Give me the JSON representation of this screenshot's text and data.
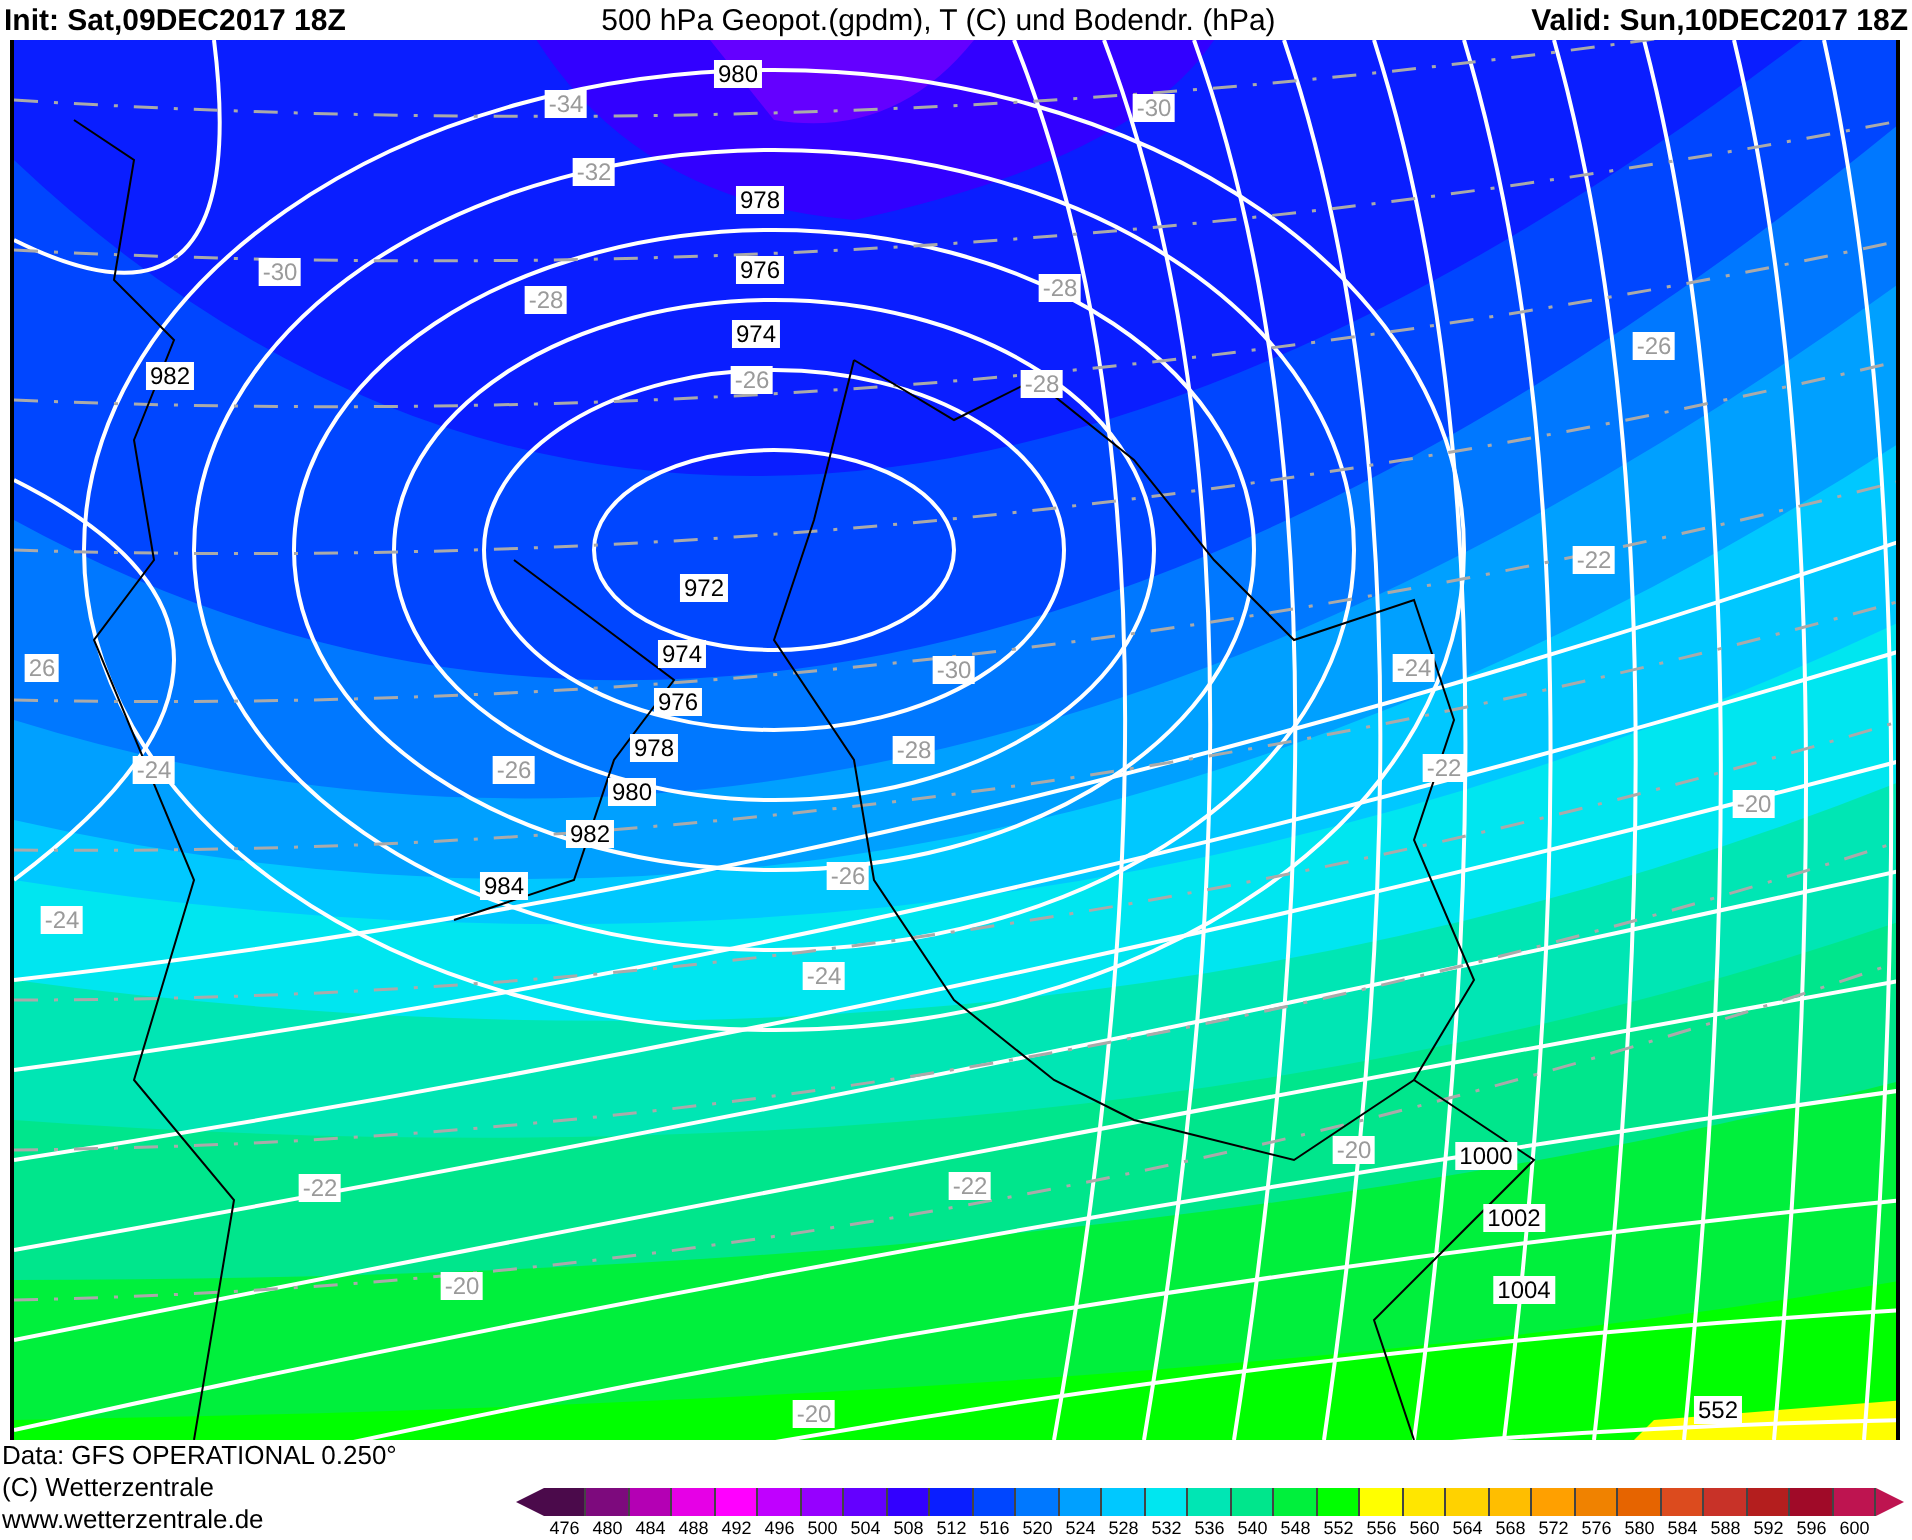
{
  "header": {
    "init": "Init: Sat,09DEC2017 18Z",
    "title": "500 hPa Geopot.(gpdm), T (C) und Bodendr. (hPa)",
    "valid": "Valid: Sun,10DEC2017 18Z"
  },
  "map": {
    "isobar_labels": [
      "980",
      "978",
      "976",
      "974",
      "982",
      "972",
      "974",
      "976",
      "978",
      "980",
      "982",
      "984",
      "1000",
      "1002",
      "1004",
      "552"
    ],
    "isotherm_labels": [
      "-34",
      "-30",
      "-32",
      "-30",
      "-28",
      "-28",
      "-26",
      "-26",
      "-28",
      "-22",
      "26",
      "-30",
      "-24",
      "-24",
      "-26",
      "-28",
      "-22",
      "-20",
      "-26",
      "-24",
      "-24",
      "-20",
      "-22",
      "-22",
      "-20",
      "-20"
    ]
  },
  "footer": {
    "lines": [
      "Data: GFS OPERATIONAL 0.250°",
      "(C) Wetterzentrale",
      "www.wetterzentrale.de"
    ]
  },
  "legend": [
    {
      "label": "476",
      "color": "#4b0a4b"
    },
    {
      "label": "480",
      "color": "#7d0a7d"
    },
    {
      "label": "484",
      "color": "#b400b4"
    },
    {
      "label": "488",
      "color": "#e600e6"
    },
    {
      "label": "492",
      "color": "#ff00ff"
    },
    {
      "label": "496",
      "color": "#c000ff"
    },
    {
      "label": "500",
      "color": "#9600ff"
    },
    {
      "label": "504",
      "color": "#6400ff"
    },
    {
      "label": "508",
      "color": "#3200ff"
    },
    {
      "label": "512",
      "color": "#0a1eff"
    },
    {
      "label": "516",
      "color": "#0046ff"
    },
    {
      "label": "520",
      "color": "#0078ff"
    },
    {
      "label": "524",
      "color": "#00a0ff"
    },
    {
      "label": "528",
      "color": "#00c8ff"
    },
    {
      "label": "532",
      "color": "#00e6f0"
    },
    {
      "label": "536",
      "color": "#00e6b4"
    },
    {
      "label": "540",
      "color": "#00e68c"
    },
    {
      "label": "548",
      "color": "#00f03c"
    },
    {
      "label": "552",
      "color": "#00ff00"
    },
    {
      "label": "556",
      "color": "#ffff00"
    },
    {
      "label": "560",
      "color": "#ffe600"
    },
    {
      "label": "564",
      "color": "#ffd200"
    },
    {
      "label": "568",
      "color": "#ffbe00"
    },
    {
      "label": "572",
      "color": "#ffa000"
    },
    {
      "label": "576",
      "color": "#f08200"
    },
    {
      "label": "580",
      "color": "#e66400"
    },
    {
      "label": "584",
      "color": "#dc4b1e"
    },
    {
      "label": "588",
      "color": "#c83228"
    },
    {
      "label": "592",
      "color": "#b41e1e"
    },
    {
      "label": "596",
      "color": "#a00a28"
    },
    {
      "label": "600",
      "color": "#be1450"
    }
  ]
}
